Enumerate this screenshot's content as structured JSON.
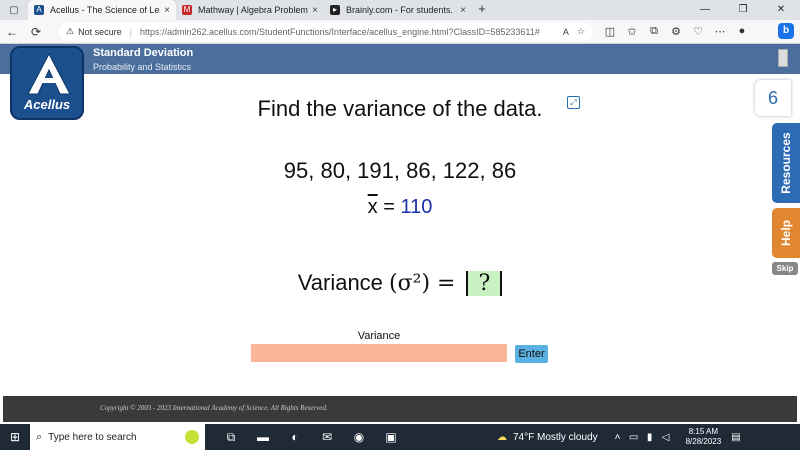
{
  "browser": {
    "tabs": [
      {
        "label": "Acellus - The Science of Learning",
        "favicon": "acellus-favicon-icon",
        "active": true
      },
      {
        "label": "Mathway | Algebra Problem Solver",
        "favicon": "mathway-favicon-icon",
        "active": false
      },
      {
        "label": "Brainly.com - For students. By stu",
        "favicon": "brainly-favicon-icon",
        "active": false
      }
    ],
    "not_secure_label": "Not secure",
    "url": "https://admin262.acellus.com/StudentFunctions/Interface/acellus_engine.html?ClassID=585233611#"
  },
  "header": {
    "title": "Standard Deviation",
    "subtitle": "Probability and Statistics",
    "logo_text": "Acellus"
  },
  "main": {
    "question": "Find the variance of the data.",
    "data_values": "95, 80, 191, 86, 122, 86",
    "mean_symbol": "x",
    "mean_equals": " = ",
    "mean_value": "110",
    "variance_label": "Variance ",
    "variance_symbol": "(σ²)",
    "variance_equals": " = ",
    "answer_placeholder": "?",
    "input_label": "Variance",
    "input_value": "",
    "enter_label": "Enter"
  },
  "side": {
    "number": "6",
    "resources_label": "Resources",
    "help_label": "Help",
    "skip_label": "Skip"
  },
  "footer": {
    "copyright": "Copyright © 2003 - 2023 International Academy of Science.  All Rights Reserved."
  },
  "taskbar": {
    "search_placeholder": "Type here to search",
    "weather": "74°F  Mostly cloudy",
    "time": "8:15 AM",
    "date": "8/28/2023"
  },
  "colors": {
    "header_bg": "#4a6f9c",
    "input_bg": "#fbb59a",
    "answer_bg": "#c9f0c1",
    "mean_color": "#1b2fa8",
    "resources_tab": "#2e6bb5",
    "help_tab": "#e0872f"
  }
}
